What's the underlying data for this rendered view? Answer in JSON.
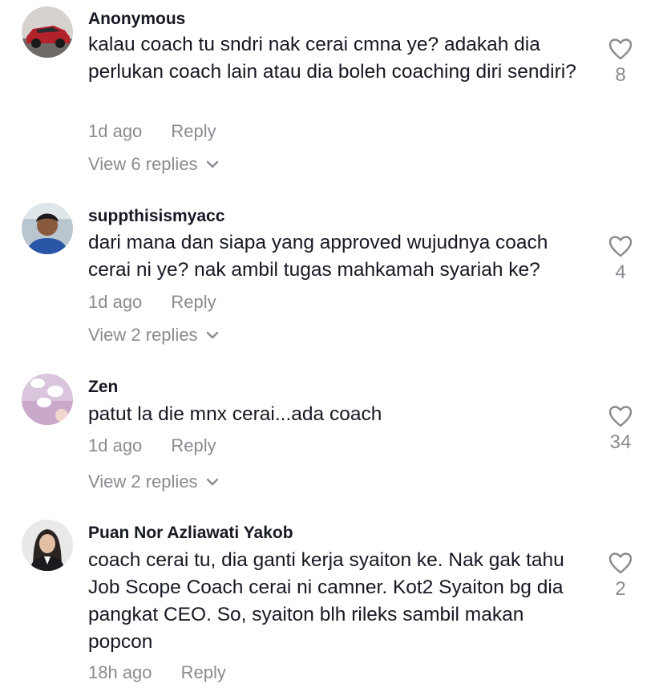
{
  "comments": [
    {
      "username": "Anonymous",
      "text": "kalau coach tu sndri nak cerai cmna ye? adakah dia perlukan coach lain atau dia boleh coaching diri sendiri?",
      "time": "1d ago",
      "reply_label": "Reply",
      "view_replies": "View 6 replies",
      "likes": "8"
    },
    {
      "username": "suppthisismyacc",
      "text": "dari mana dan siapa yang approved wujudnya coach cerai ni ye? nak ambil tugas mahkamah syariah ke?",
      "time": "1d ago",
      "reply_label": "Reply",
      "view_replies": "View 2 replies",
      "likes": "4"
    },
    {
      "username": "Zen",
      "text": "patut la die mnx cerai...ada coach",
      "time": "1d ago",
      "reply_label": "Reply",
      "view_replies": "View 2 replies",
      "likes": "34"
    },
    {
      "username": "Puan Nor Azliawati Yakob",
      "text": "coach cerai tu, dia ganti kerja syaiton ke. Nak gak tahu Job Scope Coach cerai ni camner. Kot2 Syaiton bg dia pangkat CEO. So, syaiton blh rileks sambil makan popcon",
      "time": "18h ago",
      "reply_label": "Reply",
      "likes": "2"
    }
  ],
  "icons": {
    "like": "heart-outline-icon",
    "expand": "chevron-down-icon"
  },
  "colors": {
    "text": "#161823",
    "muted": "#8a8b91"
  }
}
